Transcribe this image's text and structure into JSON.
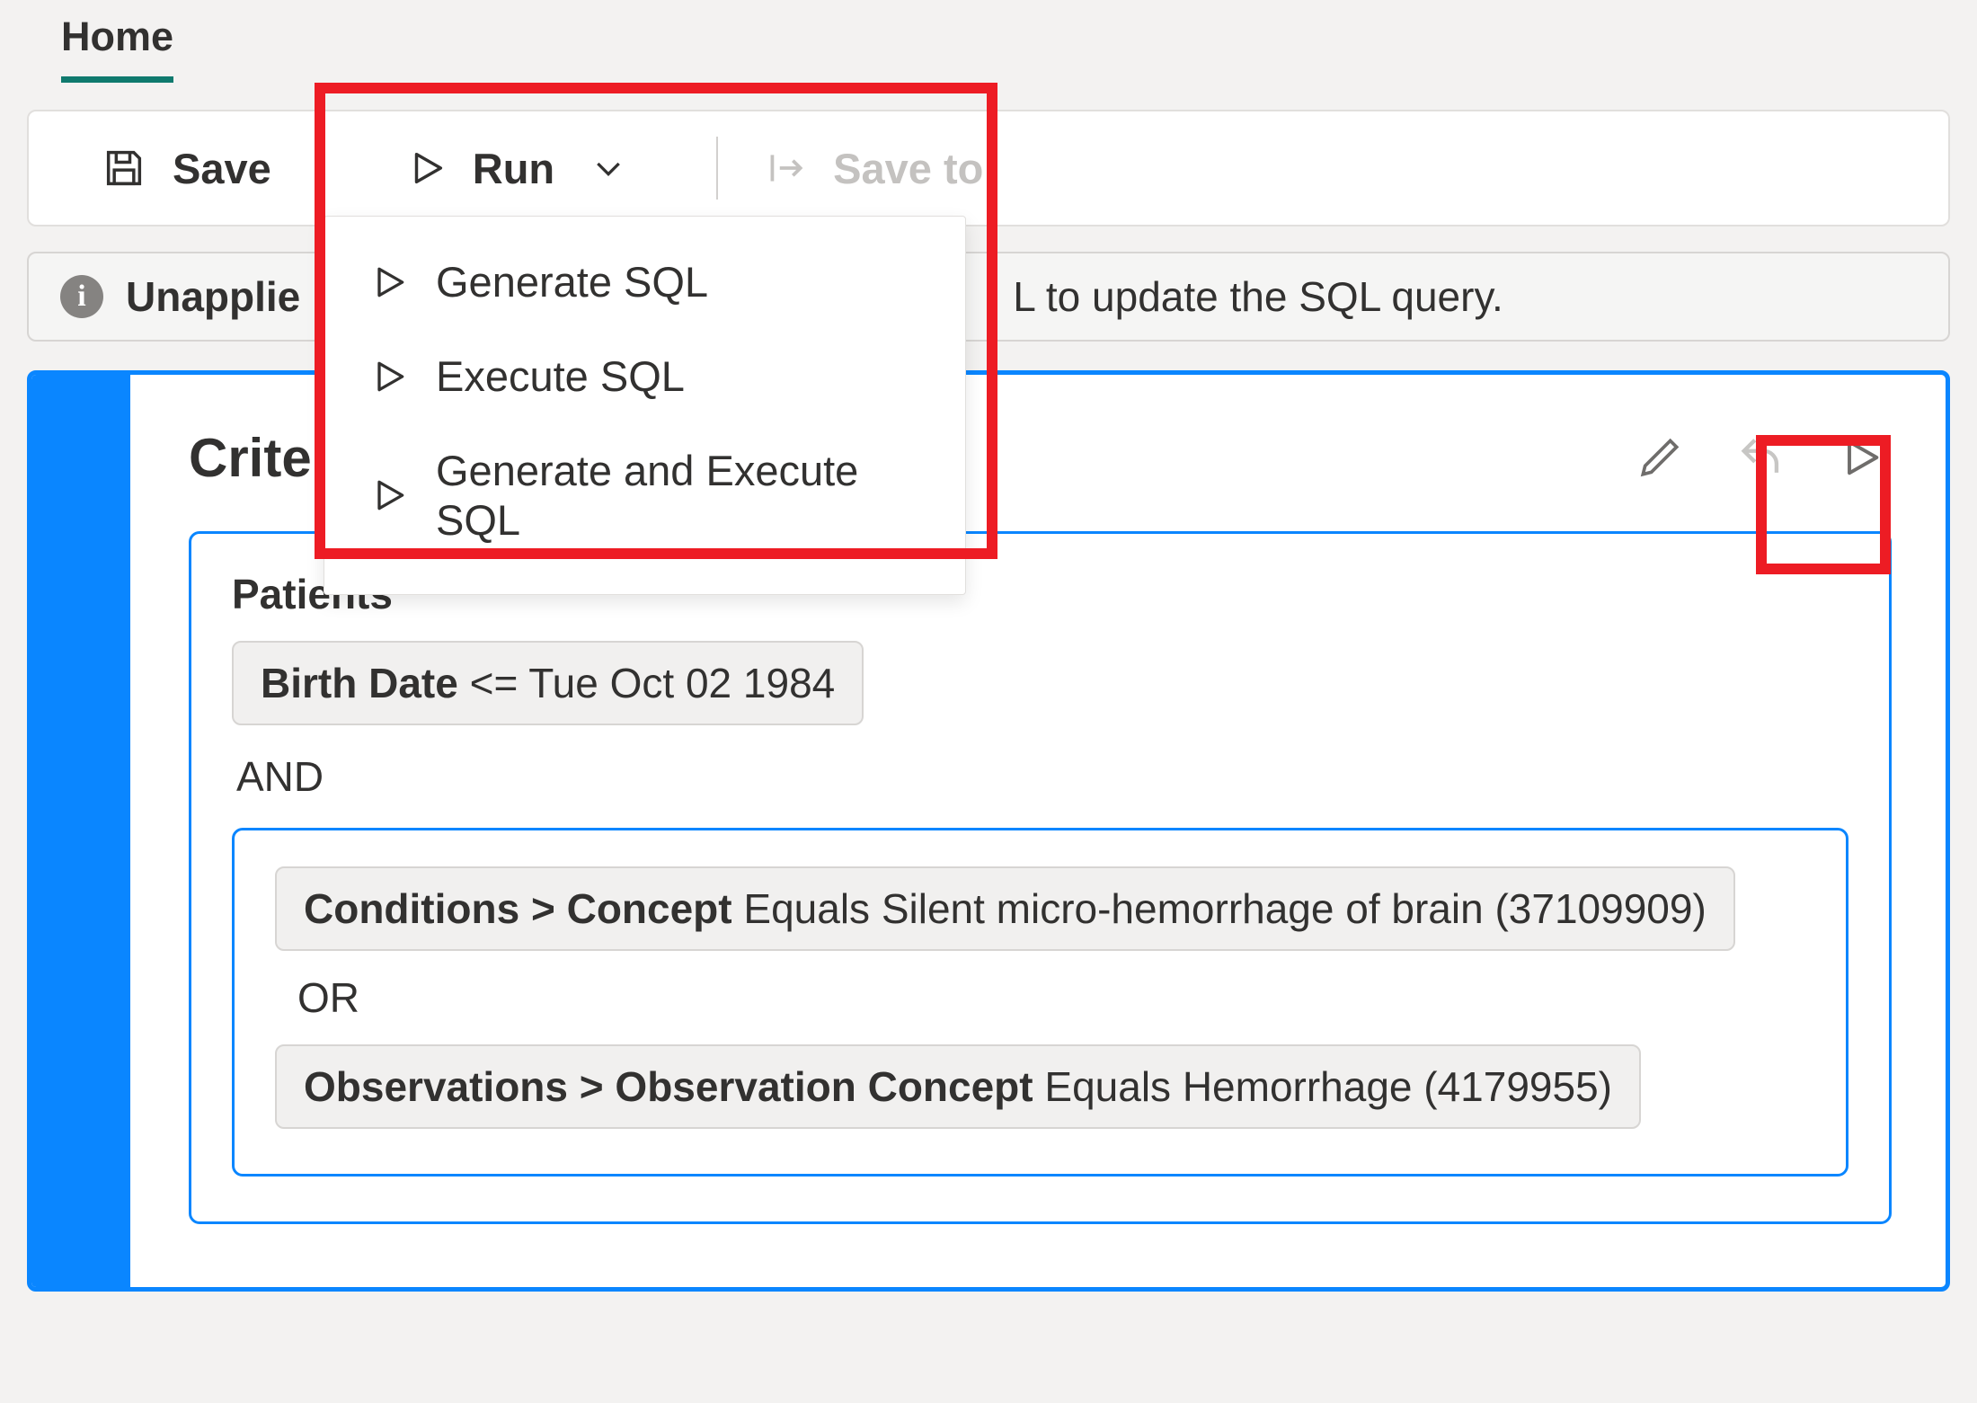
{
  "tab": {
    "home": "Home"
  },
  "toolbar": {
    "save_label": "Save",
    "run_label": "Run",
    "saveto_label": "Save to"
  },
  "run_menu": {
    "generate": "Generate SQL",
    "execute": "Execute SQL",
    "gen_exec": "Generate and Execute SQL"
  },
  "banner": {
    "prefix": "Unapplie",
    "suffix": "L to update the SQL query."
  },
  "criteria": {
    "title": "Crite",
    "patients_label": "Patients",
    "birth_field": "Birth Date",
    "birth_op": "<=",
    "birth_value": "Tue Oct 02 1984",
    "and_label": "AND",
    "cond_path": "Conditions > Concept",
    "cond_op": "Equals",
    "cond_value": "Silent micro-hemorrhage of brain (37109909)",
    "or_label": "OR",
    "obs_path": "Observations > Observation Concept",
    "obs_op": "Equals",
    "obs_value": "Hemorrhage (4179955)"
  }
}
